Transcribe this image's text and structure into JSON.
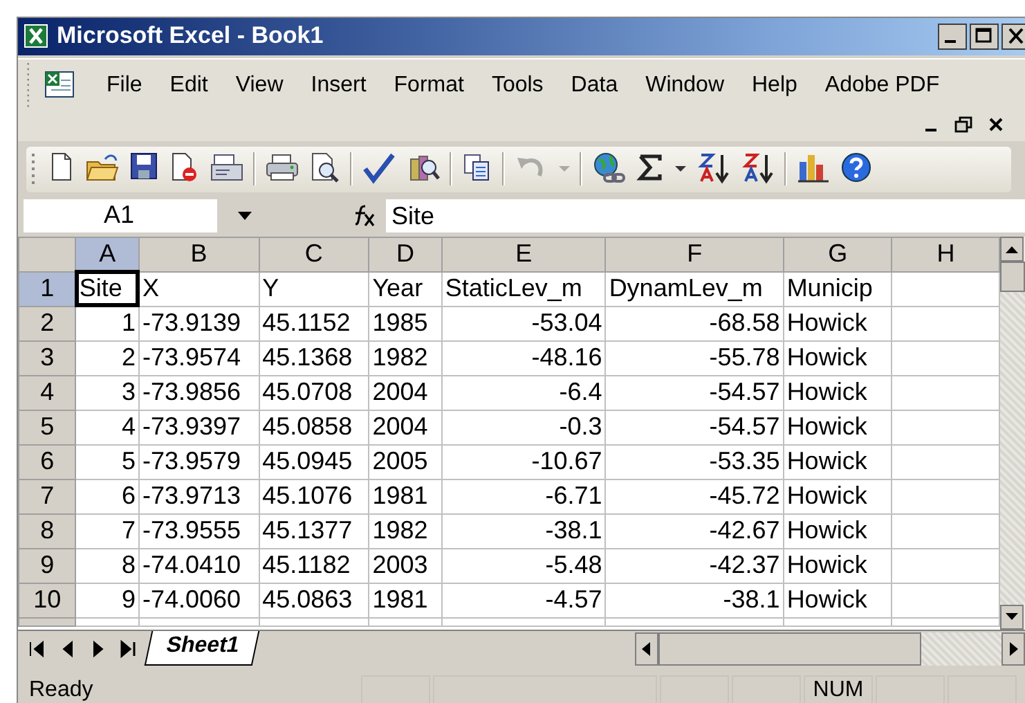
{
  "window": {
    "title": "Microsoft Excel - Book1"
  },
  "menu": [
    {
      "label": "File"
    },
    {
      "label": "Edit"
    },
    {
      "label": "View"
    },
    {
      "label": "Insert"
    },
    {
      "label": "Format"
    },
    {
      "label": "Tools"
    },
    {
      "label": "Data"
    },
    {
      "label": "Window"
    },
    {
      "label": "Help"
    },
    {
      "label": "Adobe PDF"
    }
  ],
  "toolbar": [
    {
      "kind": "new",
      "disabled": false
    },
    {
      "kind": "open",
      "disabled": false
    },
    {
      "kind": "save",
      "disabled": false
    },
    {
      "kind": "permission",
      "disabled": false
    },
    {
      "kind": "mail",
      "disabled": false
    },
    {
      "kind": "sep"
    },
    {
      "kind": "print",
      "disabled": false
    },
    {
      "kind": "preview",
      "disabled": false
    },
    {
      "kind": "sep"
    },
    {
      "kind": "spelling",
      "disabled": false
    },
    {
      "kind": "research",
      "disabled": false
    },
    {
      "kind": "sep"
    },
    {
      "kind": "copy",
      "disabled": false
    },
    {
      "kind": "sep"
    },
    {
      "kind": "undo",
      "disabled": true
    },
    {
      "kind": "dropdown",
      "disabled": true
    },
    {
      "kind": "sep"
    },
    {
      "kind": "hyperlink",
      "disabled": false
    },
    {
      "kind": "sum",
      "disabled": false
    },
    {
      "kind": "dropdown",
      "disabled": false
    },
    {
      "kind": "sortasc",
      "disabled": false
    },
    {
      "kind": "sortdesc",
      "disabled": false
    },
    {
      "kind": "sep"
    },
    {
      "kind": "chart",
      "disabled": false
    },
    {
      "kind": "help",
      "disabled": false
    }
  ],
  "name_box": {
    "value": "A1"
  },
  "formula_bar": {
    "value": "Site"
  },
  "columns": [
    {
      "label": "A",
      "selected": true
    },
    {
      "label": "B",
      "selected": false
    },
    {
      "label": "C",
      "selected": false
    },
    {
      "label": "D",
      "selected": false
    },
    {
      "label": "E",
      "selected": false
    },
    {
      "label": "F",
      "selected": false
    },
    {
      "label": "G",
      "selected": false
    },
    {
      "label": "H",
      "selected": false
    }
  ],
  "rows": [
    {
      "header": "1",
      "selected": true,
      "cells": [
        {
          "text": "Site",
          "numeric": false
        },
        {
          "text": "X",
          "numeric": false
        },
        {
          "text": "Y",
          "numeric": false
        },
        {
          "text": "Year",
          "numeric": false
        },
        {
          "text": "StaticLev_m",
          "numeric": false
        },
        {
          "text": "DynamLev_m",
          "numeric": false
        },
        {
          "text": "Municip",
          "numeric": false
        }
      ]
    },
    {
      "header": "2",
      "selected": false,
      "cells": [
        {
          "text": "1",
          "numeric": true
        },
        {
          "text": "-73.9139",
          "numeric": false
        },
        {
          "text": "45.1152",
          "numeric": false
        },
        {
          "text": "1985",
          "numeric": false
        },
        {
          "text": "-53.04",
          "numeric": true
        },
        {
          "text": "-68.58",
          "numeric": true
        },
        {
          "text": "Howick",
          "numeric": false
        }
      ]
    },
    {
      "header": "3",
      "selected": false,
      "cells": [
        {
          "text": "2",
          "numeric": true
        },
        {
          "text": "-73.9574",
          "numeric": false
        },
        {
          "text": "45.1368",
          "numeric": false
        },
        {
          "text": "1982",
          "numeric": false
        },
        {
          "text": "-48.16",
          "numeric": true
        },
        {
          "text": "-55.78",
          "numeric": true
        },
        {
          "text": "Howick",
          "numeric": false
        }
      ]
    },
    {
      "header": "4",
      "selected": false,
      "cells": [
        {
          "text": "3",
          "numeric": true
        },
        {
          "text": "-73.9856",
          "numeric": false
        },
        {
          "text": "45.0708",
          "numeric": false
        },
        {
          "text": "2004",
          "numeric": false
        },
        {
          "text": "-6.4",
          "numeric": true
        },
        {
          "text": "-54.57",
          "numeric": true
        },
        {
          "text": "Howick",
          "numeric": false
        }
      ]
    },
    {
      "header": "5",
      "selected": false,
      "cells": [
        {
          "text": "4",
          "numeric": true
        },
        {
          "text": "-73.9397",
          "numeric": false
        },
        {
          "text": "45.0858",
          "numeric": false
        },
        {
          "text": "2004",
          "numeric": false
        },
        {
          "text": "-0.3",
          "numeric": true
        },
        {
          "text": "-54.57",
          "numeric": true
        },
        {
          "text": "Howick",
          "numeric": false
        }
      ]
    },
    {
      "header": "6",
      "selected": false,
      "cells": [
        {
          "text": "5",
          "numeric": true
        },
        {
          "text": "-73.9579",
          "numeric": false
        },
        {
          "text": "45.0945",
          "numeric": false
        },
        {
          "text": "2005",
          "numeric": false
        },
        {
          "text": "-10.67",
          "numeric": true
        },
        {
          "text": "-53.35",
          "numeric": true
        },
        {
          "text": "Howick",
          "numeric": false
        }
      ]
    },
    {
      "header": "7",
      "selected": false,
      "cells": [
        {
          "text": "6",
          "numeric": true
        },
        {
          "text": "-73.9713",
          "numeric": false
        },
        {
          "text": "45.1076",
          "numeric": false
        },
        {
          "text": "1981",
          "numeric": false
        },
        {
          "text": "-6.71",
          "numeric": true
        },
        {
          "text": "-45.72",
          "numeric": true
        },
        {
          "text": "Howick",
          "numeric": false
        }
      ]
    },
    {
      "header": "8",
      "selected": false,
      "cells": [
        {
          "text": "7",
          "numeric": true
        },
        {
          "text": "-73.9555",
          "numeric": false
        },
        {
          "text": "45.1377",
          "numeric": false
        },
        {
          "text": "1982",
          "numeric": false
        },
        {
          "text": "-38.1",
          "numeric": true
        },
        {
          "text": "-42.67",
          "numeric": true
        },
        {
          "text": "Howick",
          "numeric": false
        }
      ]
    },
    {
      "header": "9",
      "selected": false,
      "cells": [
        {
          "text": "8",
          "numeric": true
        },
        {
          "text": "-74.0410",
          "numeric": false
        },
        {
          "text": "45.1182",
          "numeric": false
        },
        {
          "text": "2003",
          "numeric": false
        },
        {
          "text": "-5.48",
          "numeric": true
        },
        {
          "text": "-42.37",
          "numeric": true
        },
        {
          "text": "Howick",
          "numeric": false
        }
      ]
    },
    {
      "header": "10",
      "selected": false,
      "cells": [
        {
          "text": "9",
          "numeric": true
        },
        {
          "text": "-74.0060",
          "numeric": false
        },
        {
          "text": "45.0863",
          "numeric": false
        },
        {
          "text": "1981",
          "numeric": false
        },
        {
          "text": "-4.57",
          "numeric": true
        },
        {
          "text": "-38.1",
          "numeric": true
        },
        {
          "text": "Howick",
          "numeric": false
        }
      ]
    }
  ],
  "sheet_tabs": [
    {
      "label": "Sheet1",
      "selected": true
    }
  ],
  "status_bar": {
    "message": "Ready",
    "indicators": [
      {
        "label": "NUM"
      }
    ]
  }
}
